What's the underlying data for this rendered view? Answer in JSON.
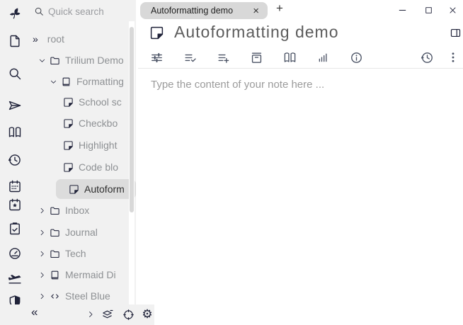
{
  "colors": {
    "sidebar_bg": "#f1f1f1",
    "icon_dark": "#20233a",
    "selected_item_bg": "#dcdcdc",
    "active_tab_bg": "#d8d8d8",
    "ribbon_icon": "#4a5264",
    "placeholder_text": "#9b9b9b"
  },
  "launcher": {
    "icons": [
      {
        "name": "trilium-logo"
      },
      {
        "name": "new-note-icon"
      },
      {
        "name": "search-icon"
      },
      {
        "name": "jump-to-note-icon"
      },
      {
        "name": "note-map-book-icon"
      },
      {
        "name": "recent-changes-clock-icon"
      },
      {
        "name": "calendar-icon"
      },
      {
        "name": "today-calendar-star-icon"
      },
      {
        "name": "task-clipboard-check-icon"
      },
      {
        "name": "dashboard-gauge-icon"
      },
      {
        "name": "travel-plane-icon"
      },
      {
        "name": "protected-session-shield-icon"
      }
    ]
  },
  "quick_search": {
    "placeholder": "Quick search"
  },
  "tree": {
    "root_expander_glyph": "»",
    "items": [
      {
        "label": "root",
        "level": 0
      },
      {
        "label": "Trilium Demo",
        "level": 1,
        "icon": "folder",
        "expanded": true
      },
      {
        "label": "Formatting",
        "level": 2,
        "icon": "book",
        "expanded": true
      },
      {
        "label": "School sc",
        "level": 3,
        "icon": "note"
      },
      {
        "label": "Checkbo",
        "level": 3,
        "icon": "note"
      },
      {
        "label": "Highlight",
        "level": 3,
        "icon": "note"
      },
      {
        "label": "Code blo",
        "level": 3,
        "icon": "note"
      },
      {
        "label": "Autoform",
        "level": 3,
        "icon": "note",
        "selected": true
      },
      {
        "label": "Inbox",
        "level": 1,
        "icon": "folder",
        "expanded": false
      },
      {
        "label": "Journal",
        "level": 1,
        "icon": "folder",
        "expanded": false
      },
      {
        "label": "Tech",
        "level": 1,
        "icon": "folder",
        "expanded": false
      },
      {
        "label": "Mermaid Di",
        "level": 1,
        "icon": "book",
        "expanded": false
      },
      {
        "label": "Steel Blue",
        "level": 1,
        "icon": "code",
        "expanded": false
      }
    ]
  },
  "tree_bottom": {
    "collapse_glyph": "«",
    "gear_glyph": "⚙",
    "icons": [
      {
        "name": "chevron-right-icon"
      },
      {
        "name": "layers-icon"
      },
      {
        "name": "crosshair-icon"
      },
      {
        "name": "gear-icon"
      }
    ]
  },
  "tabbar": {
    "active_tab": "Autoformatting demo",
    "close_glyph": "×",
    "new_tab_glyph": "+"
  },
  "window_controls": {
    "minimize": "minimize",
    "maximize": "maximize",
    "close": "close"
  },
  "note": {
    "title": "Autoformatting demo",
    "content_placeholder": "Type the content of your note here ..."
  },
  "ribbon": {
    "icons": [
      {
        "name": "basic-properties-sliders-icon"
      },
      {
        "name": "owned-attributes-list-check-icon"
      },
      {
        "name": "promoted-attributes-list-plus-icon"
      },
      {
        "name": "note-paths-archive-icon"
      },
      {
        "name": "note-map-icon"
      },
      {
        "name": "similar-notes-bar-chart-icon"
      },
      {
        "name": "note-info-icon"
      },
      {
        "name": "revisions-history-icon"
      },
      {
        "name": "more-menu-dots-icon"
      }
    ]
  }
}
